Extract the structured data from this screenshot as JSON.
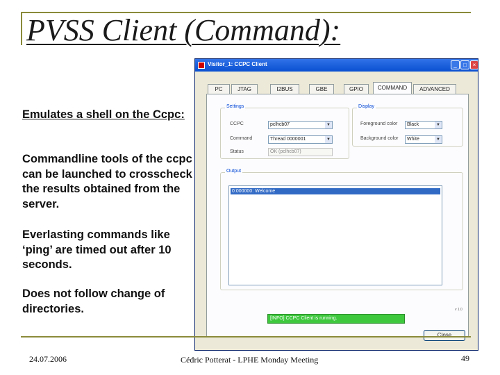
{
  "slide": {
    "title": "PVSS Client (Command):",
    "bullets": [
      "Emulates a shell on the Ccpc:",
      "Commandline tools of the ccpc can be launched to crosscheck the results obtained from the server.",
      "Everlasting commands like ‘ping’ are timed out after 10 seconds.",
      "Does not follow change of directories."
    ],
    "footer": {
      "date": "24.07.2006",
      "center": "Cédric Potterat - LPHE Monday Meeting",
      "page": "49"
    }
  },
  "window": {
    "title": "Visitor_1: CCPC Client",
    "buttons": {
      "minimize": "_",
      "maximize": "□",
      "close": "×"
    },
    "tabs": [
      "PC",
      "JTAG",
      "I2BUS",
      "GBE",
      "GPIO",
      "COMMAND",
      "ADVANCED"
    ],
    "active_tab": "COMMAND",
    "settings": {
      "label": "Settings",
      "ccpc_label": "CCPC",
      "ccpc_value": "pclhcb07",
      "command_label": "Command",
      "command_value": "Thread 0000001",
      "status_label": "Status",
      "status_value": "OK (pclhcb07)"
    },
    "display": {
      "label": "Display",
      "foreground_label": "Foreground color",
      "foreground_value": "Black",
      "background_label": "Background color",
      "background_value": "White"
    },
    "output": {
      "label": "Output",
      "lines": [
        "0:000000: Welcome"
      ]
    },
    "status_message": "[INFO] CCPC Client is running.",
    "corner_text": "v 1.0",
    "close_label": "Close"
  },
  "colors": {
    "title_bar": "#0a4fd0",
    "status_green": "#3ec83e",
    "selection": "#316ac5",
    "frame_olive": "#8a8a3a"
  }
}
